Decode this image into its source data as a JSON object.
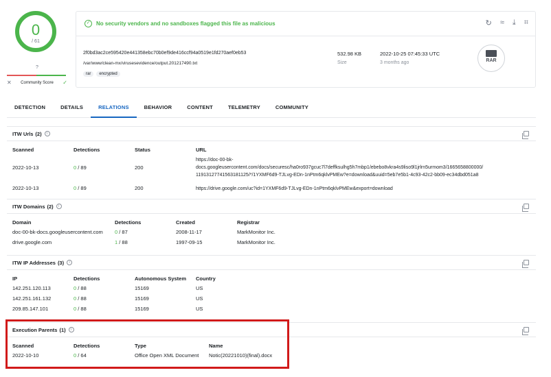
{
  "score": {
    "positives": "0",
    "total": "/ 61",
    "community_label": "?",
    "community_score_label": "Community Score",
    "accent_color": "#4bb54b"
  },
  "banner": {
    "message": "No security vendors and no sandboxes flagged this file as malicious"
  },
  "file": {
    "hash": "2f0bd3ac2ce595420e441358ebc70b0ef9de416ccf94a0519e1fd270aef0eb53",
    "path": "/var/www/clean-mx/virusesevidence/output.201217490.txt",
    "tags": [
      "rar",
      "encrypted"
    ],
    "size_value": "532.98 KB",
    "size_label": "Size",
    "date_value": "2022-10-25 07:45:33 UTC",
    "date_label": "3 months ago",
    "type_badge": "RAR"
  },
  "tabs": [
    "DETECTION",
    "DETAILS",
    "RELATIONS",
    "BEHAVIOR",
    "CONTENT",
    "TELEMETRY",
    "COMMUNITY"
  ],
  "active_tab": "RELATIONS",
  "itw_urls": {
    "title": "ITW Urls",
    "count": "(2)",
    "headers": [
      "Scanned",
      "Detections",
      "Status",
      "URL"
    ],
    "rows": [
      {
        "scanned": "2022-10-13",
        "det_pos": "0",
        "det_total": " / 89",
        "status": "200",
        "url_lines": [
          "https://doc-00-bk-",
          "docs.googleusercontent.com/docs/securesc/ha0ro937gcuc7l7deffksulhg5h7mbp1/ebebo8vkra4s9liso9l1jrlrn5urmom3/1665658800000/",
          "11913127741563181125/*/1YXMF6d9-TJLvg-EDn-1nPtm6qklvPMEw?e=download&uuid=5eb7e5b1-4c93-42c2-bb09-ec34dbd051a8"
        ]
      },
      {
        "scanned": "2022-10-13",
        "det_pos": "0",
        "det_total": " / 89",
        "status": "200",
        "url_lines": [
          "https://drive.google.com/uc?id=1YXMF6d9-TJLvg-EDn-1nPtm6qklvPMEw&export=download"
        ]
      }
    ]
  },
  "itw_domains": {
    "title": "ITW Domains",
    "count": "(2)",
    "headers": [
      "Domain",
      "Detections",
      "Created",
      "Registrar"
    ],
    "rows": [
      {
        "domain": "doc-00-bk-docs.googleusercontent.com",
        "det_pos": "0",
        "det_total": " / 87",
        "created": "2008-11-17",
        "registrar": "MarkMonitor Inc."
      },
      {
        "domain": "drive.google.com",
        "det_pos": "1",
        "det_total": " / 88",
        "created": "1997-09-15",
        "registrar": "MarkMonitor Inc."
      }
    ]
  },
  "itw_ips": {
    "title": "ITW IP Addresses",
    "count": "(3)",
    "headers": [
      "IP",
      "Detections",
      "Autonomous System",
      "Country"
    ],
    "rows": [
      {
        "ip": "142.251.120.113",
        "det_pos": "0",
        "det_total": " / 88",
        "as": "15169",
        "country": "US"
      },
      {
        "ip": "142.251.161.132",
        "det_pos": "0",
        "det_total": " / 88",
        "as": "15169",
        "country": "US"
      },
      {
        "ip": "209.85.147.101",
        "det_pos": "0",
        "det_total": " / 88",
        "as": "15169",
        "country": "US"
      }
    ]
  },
  "exec_parents": {
    "title": "Execution Parents",
    "count": "(1)",
    "headers": [
      "Scanned",
      "Detections",
      "Type",
      "Name"
    ],
    "rows": [
      {
        "scanned": "2022-10-10",
        "det_pos": "0",
        "det_total": " / 64",
        "type": "Office Open XML Document",
        "name": "Notic(20221010)(final).docx"
      }
    ]
  }
}
